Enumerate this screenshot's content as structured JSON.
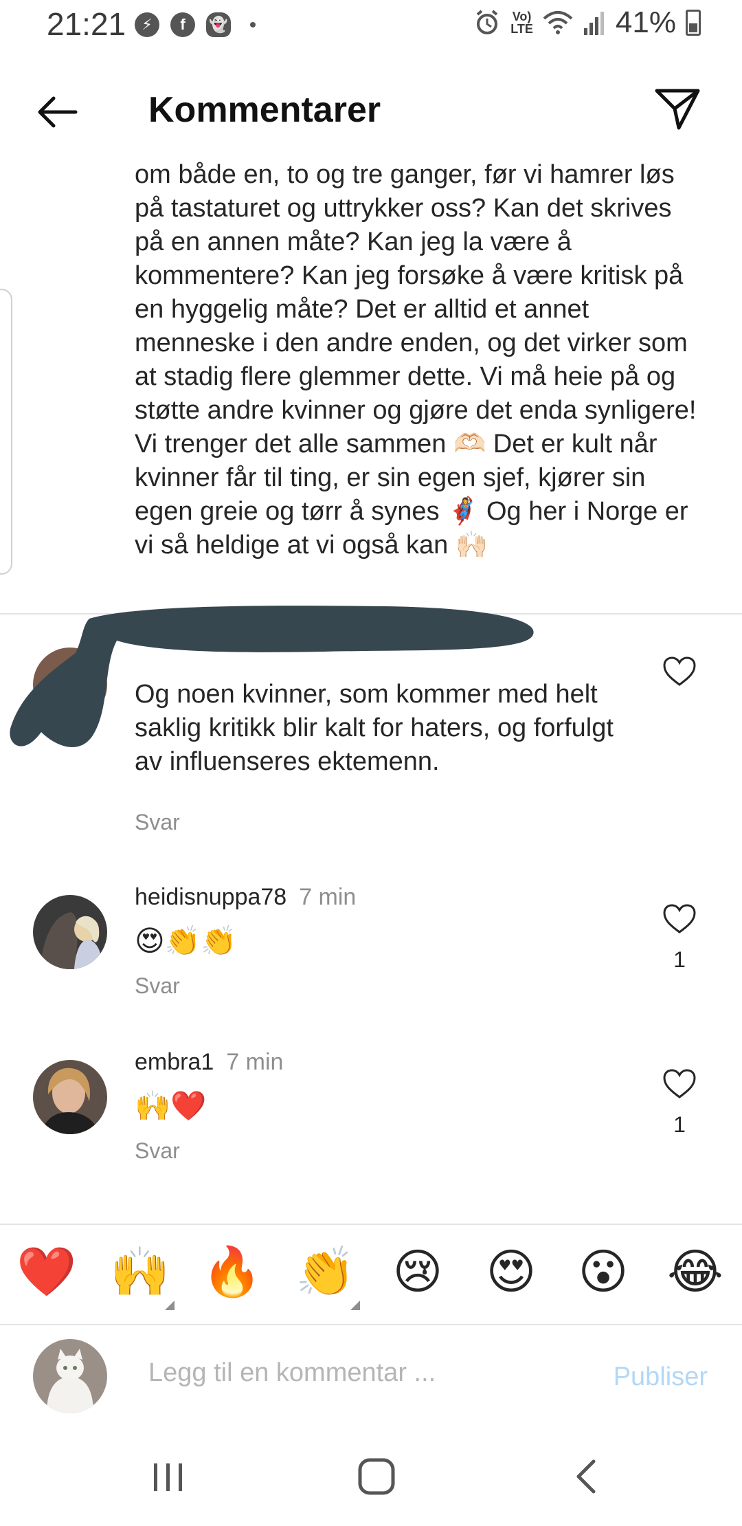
{
  "status_bar": {
    "time": "21:21",
    "battery": "41%",
    "lte_top": "Vo)",
    "lte_bottom": "LTE"
  },
  "header": {
    "title": "Kommentarer"
  },
  "long_comment": {
    "text": "om både en, to og tre ganger, før vi hamrer løs på tastaturet og uttrykker oss? Kan det skrives på en annen måte? Kan jeg la være å kommentere? Kan jeg forsøke å være kritisk på en hyggelig måte? Det er alltid et annet menneske i den andre enden, og det virker som at stadig flere glemmer dette. Vi må heie på og støtte andre kvinner og gjøre det enda synligere! Vi trenger det alle sammen 🫶🏻 Det er kult når kvinner får til ting, er sin egen sjef, kjører sin egen greie og tørr å synes 🦸‍♀️ Og her i Norge er vi så heldige at vi også kan 🙌🏻"
  },
  "comments": [
    {
      "text": "Og noen kvinner, som kommer med helt saklig kritikk blir kalt for haters, og forfulgt av influenseres ektemenn.",
      "reply": "Svar"
    },
    {
      "username": "heidisnuppa78",
      "time": "7 min",
      "text": "😍👏👏",
      "reply": "Svar",
      "likes": "1"
    },
    {
      "username": "embra1",
      "time": "7 min",
      "text": "🙌❤️",
      "reply": "Svar",
      "likes": "1"
    }
  ],
  "emoji_bar": [
    "❤️",
    "🙌",
    "🔥",
    "👏",
    "😢",
    "😍",
    "😮",
    "😂"
  ],
  "compose": {
    "placeholder": "Legg til en kommentar ...",
    "publish": "Publiser"
  },
  "colors": {
    "publish_disabled": "#b3d7f6",
    "secondary_text": "#8e8e8e",
    "scribble": "#37474f"
  }
}
